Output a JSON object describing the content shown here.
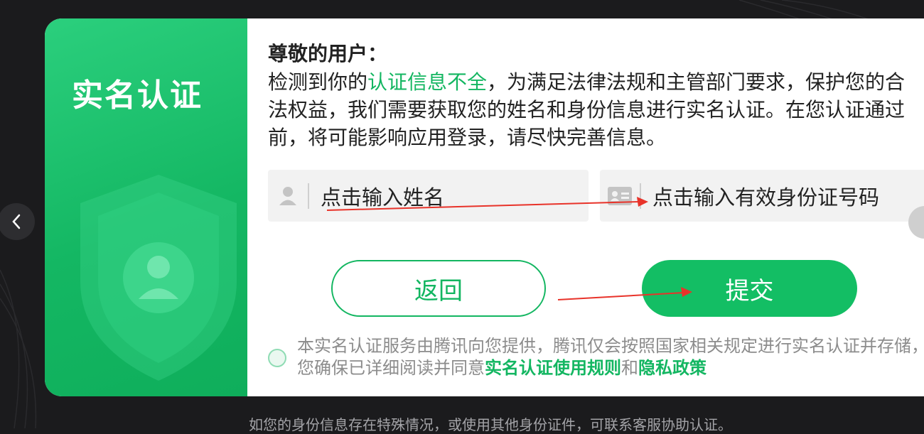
{
  "dialog": {
    "panel_title": "实名认证",
    "greeting": "尊敬的用户：",
    "notice": {
      "before": "检测到你的",
      "highlight": "认证信息不全",
      "after": "，为满足法律法规和主管部门要求，保护您的合法权益，我们需要获取您的姓名和身份信息进行实名认证。在您认证通过前，将可能影响应用登录，请尽快完善信息。"
    },
    "name_input": {
      "placeholder": "点击输入姓名",
      "icon": "user-icon"
    },
    "id_input": {
      "placeholder": "点击输入有效身份证号码",
      "icon": "id-card-icon"
    },
    "back_button": "返回",
    "submit_button": "提交",
    "agreement": {
      "text": "本实名认证服务由腾讯向您提供，腾讯仅会按照国家相关规定进行实名认证并存储，您确保已详细阅读并同意",
      "link1": "实名认证使用规则",
      "and": "和",
      "link2": "隐私政策"
    }
  },
  "footer_note": "如您的身份信息存在特殊情况，或使用其他身份证件，可联系客服协助认证。",
  "colors": {
    "accent": "#13b661",
    "panel_green": "#14b763",
    "background": "#1b1b1d",
    "annotation_arrow": "#e8332a"
  }
}
